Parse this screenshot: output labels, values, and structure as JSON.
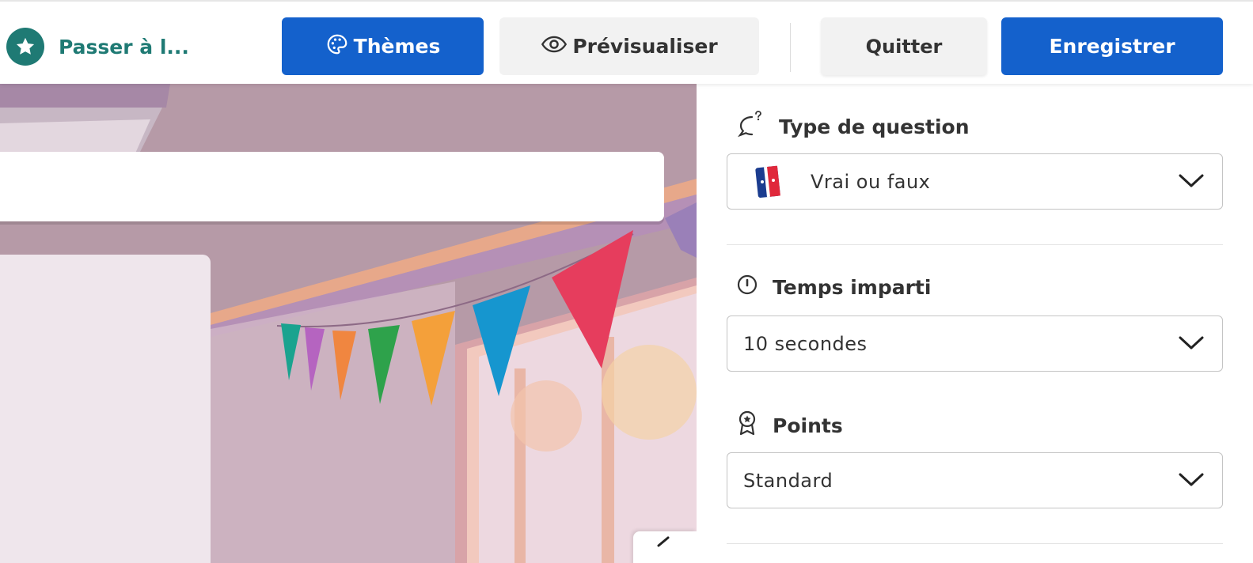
{
  "header": {
    "upgrade_label": "Passer à l...",
    "themes_label": "Thèmes",
    "preview_label": "Prévisualiser",
    "quit_label": "Quitter",
    "save_label": "Enregistrer"
  },
  "settings": {
    "question_type": {
      "title": "Type de question",
      "value": "Vrai ou faux",
      "icon": "question-bubble-icon"
    },
    "time_limit": {
      "title": "Temps imparti",
      "value": "10 secondes",
      "icon": "timer-icon"
    },
    "points": {
      "title": "Points",
      "value": "Standard",
      "icon": "award-ribbon-icon"
    }
  },
  "colors": {
    "primary_blue": "#1461cc",
    "brand_teal": "#1f7a74",
    "neutral_button": "#f2f2f2"
  }
}
